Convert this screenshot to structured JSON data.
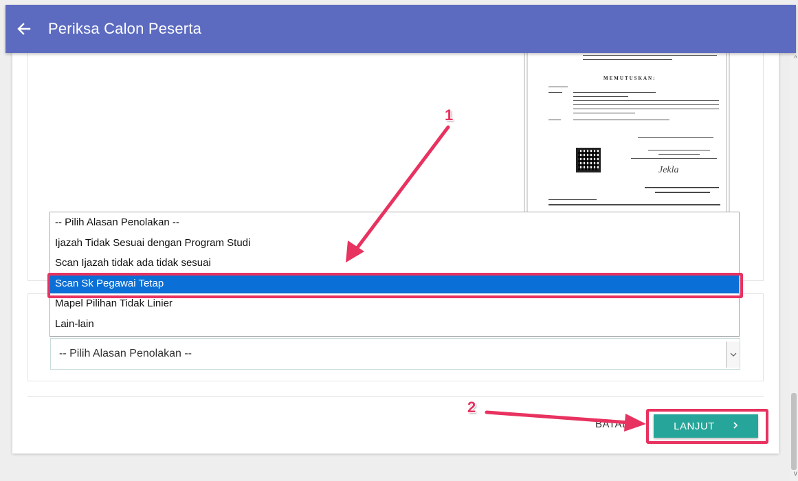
{
  "header": {
    "title": "Periksa Calon Peserta",
    "color": "#5c6bc0"
  },
  "dropdown": {
    "options": [
      "-- Pilih Alasan Penolakan --",
      "Ijazah Tidak Sesuai dengan Program Studi",
      "Scan Ijazah tidak ada tidak sesuai",
      "Scan Sk Pegawai Tetap",
      "Mapel Pilihan Tidak Linier",
      "Lain-lain"
    ],
    "highlighted_option": "Scan Sk Pegawai Tetap",
    "selected_value": "-- Pilih Alasan Penolakan --"
  },
  "footer": {
    "cancel_label": "BATAL",
    "next_label": "LANJUT",
    "next_arrow": "›",
    "next_color": "#26a69a"
  },
  "annotations": {
    "step1": "1",
    "step2": "2",
    "color": "#e8325f"
  },
  "icons": {
    "back": "arrow-left-icon",
    "select_arrow": "chevron-down-icon",
    "next_arrow": "chevron-right-icon"
  }
}
